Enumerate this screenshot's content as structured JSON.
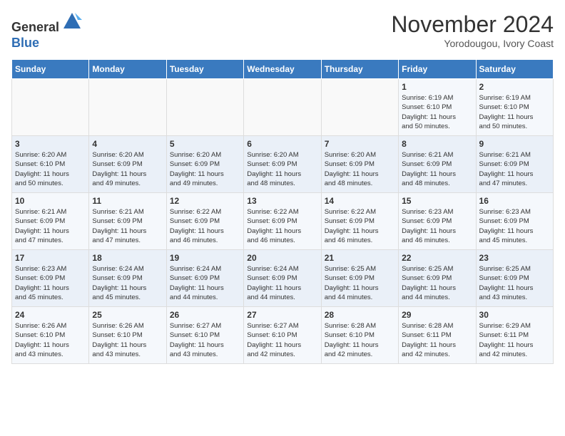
{
  "header": {
    "logo_line1": "General",
    "logo_line2": "Blue",
    "month": "November 2024",
    "location": "Yorodougou, Ivory Coast"
  },
  "weekdays": [
    "Sunday",
    "Monday",
    "Tuesday",
    "Wednesday",
    "Thursday",
    "Friday",
    "Saturday"
  ],
  "weeks": [
    [
      {
        "day": "",
        "info": ""
      },
      {
        "day": "",
        "info": ""
      },
      {
        "day": "",
        "info": ""
      },
      {
        "day": "",
        "info": ""
      },
      {
        "day": "",
        "info": ""
      },
      {
        "day": "1",
        "info": "Sunrise: 6:19 AM\nSunset: 6:10 PM\nDaylight: 11 hours\nand 50 minutes."
      },
      {
        "day": "2",
        "info": "Sunrise: 6:19 AM\nSunset: 6:10 PM\nDaylight: 11 hours\nand 50 minutes."
      }
    ],
    [
      {
        "day": "3",
        "info": "Sunrise: 6:20 AM\nSunset: 6:10 PM\nDaylight: 11 hours\nand 50 minutes."
      },
      {
        "day": "4",
        "info": "Sunrise: 6:20 AM\nSunset: 6:09 PM\nDaylight: 11 hours\nand 49 minutes."
      },
      {
        "day": "5",
        "info": "Sunrise: 6:20 AM\nSunset: 6:09 PM\nDaylight: 11 hours\nand 49 minutes."
      },
      {
        "day": "6",
        "info": "Sunrise: 6:20 AM\nSunset: 6:09 PM\nDaylight: 11 hours\nand 48 minutes."
      },
      {
        "day": "7",
        "info": "Sunrise: 6:20 AM\nSunset: 6:09 PM\nDaylight: 11 hours\nand 48 minutes."
      },
      {
        "day": "8",
        "info": "Sunrise: 6:21 AM\nSunset: 6:09 PM\nDaylight: 11 hours\nand 48 minutes."
      },
      {
        "day": "9",
        "info": "Sunrise: 6:21 AM\nSunset: 6:09 PM\nDaylight: 11 hours\nand 47 minutes."
      }
    ],
    [
      {
        "day": "10",
        "info": "Sunrise: 6:21 AM\nSunset: 6:09 PM\nDaylight: 11 hours\nand 47 minutes."
      },
      {
        "day": "11",
        "info": "Sunrise: 6:21 AM\nSunset: 6:09 PM\nDaylight: 11 hours\nand 47 minutes."
      },
      {
        "day": "12",
        "info": "Sunrise: 6:22 AM\nSunset: 6:09 PM\nDaylight: 11 hours\nand 46 minutes."
      },
      {
        "day": "13",
        "info": "Sunrise: 6:22 AM\nSunset: 6:09 PM\nDaylight: 11 hours\nand 46 minutes."
      },
      {
        "day": "14",
        "info": "Sunrise: 6:22 AM\nSunset: 6:09 PM\nDaylight: 11 hours\nand 46 minutes."
      },
      {
        "day": "15",
        "info": "Sunrise: 6:23 AM\nSunset: 6:09 PM\nDaylight: 11 hours\nand 46 minutes."
      },
      {
        "day": "16",
        "info": "Sunrise: 6:23 AM\nSunset: 6:09 PM\nDaylight: 11 hours\nand 45 minutes."
      }
    ],
    [
      {
        "day": "17",
        "info": "Sunrise: 6:23 AM\nSunset: 6:09 PM\nDaylight: 11 hours\nand 45 minutes."
      },
      {
        "day": "18",
        "info": "Sunrise: 6:24 AM\nSunset: 6:09 PM\nDaylight: 11 hours\nand 45 minutes."
      },
      {
        "day": "19",
        "info": "Sunrise: 6:24 AM\nSunset: 6:09 PM\nDaylight: 11 hours\nand 44 minutes."
      },
      {
        "day": "20",
        "info": "Sunrise: 6:24 AM\nSunset: 6:09 PM\nDaylight: 11 hours\nand 44 minutes."
      },
      {
        "day": "21",
        "info": "Sunrise: 6:25 AM\nSunset: 6:09 PM\nDaylight: 11 hours\nand 44 minutes."
      },
      {
        "day": "22",
        "info": "Sunrise: 6:25 AM\nSunset: 6:09 PM\nDaylight: 11 hours\nand 44 minutes."
      },
      {
        "day": "23",
        "info": "Sunrise: 6:25 AM\nSunset: 6:09 PM\nDaylight: 11 hours\nand 43 minutes."
      }
    ],
    [
      {
        "day": "24",
        "info": "Sunrise: 6:26 AM\nSunset: 6:10 PM\nDaylight: 11 hours\nand 43 minutes."
      },
      {
        "day": "25",
        "info": "Sunrise: 6:26 AM\nSunset: 6:10 PM\nDaylight: 11 hours\nand 43 minutes."
      },
      {
        "day": "26",
        "info": "Sunrise: 6:27 AM\nSunset: 6:10 PM\nDaylight: 11 hours\nand 43 minutes."
      },
      {
        "day": "27",
        "info": "Sunrise: 6:27 AM\nSunset: 6:10 PM\nDaylight: 11 hours\nand 42 minutes."
      },
      {
        "day": "28",
        "info": "Sunrise: 6:28 AM\nSunset: 6:10 PM\nDaylight: 11 hours\nand 42 minutes."
      },
      {
        "day": "29",
        "info": "Sunrise: 6:28 AM\nSunset: 6:11 PM\nDaylight: 11 hours\nand 42 minutes."
      },
      {
        "day": "30",
        "info": "Sunrise: 6:29 AM\nSunset: 6:11 PM\nDaylight: 11 hours\nand 42 minutes."
      }
    ]
  ]
}
